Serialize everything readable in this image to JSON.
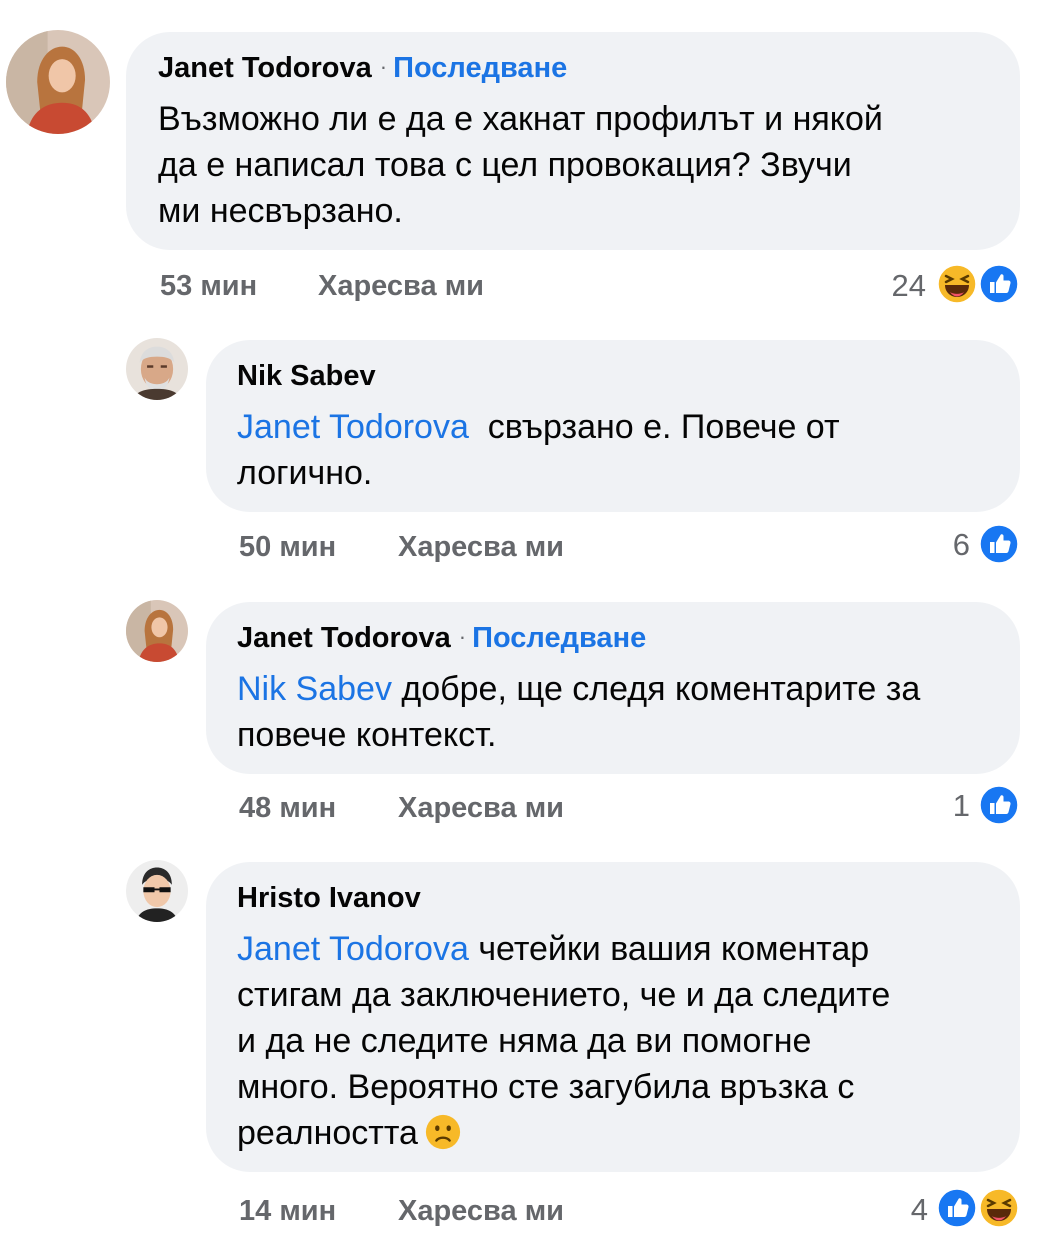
{
  "comments": [
    {
      "author": "Janet Todorova",
      "follow": "Последване",
      "mention": "",
      "lines": [
        "Възможно ли е да е хакнат профилът и някой",
        "да е написал това с цел провокация? Звучи",
        "ми несвързано."
      ],
      "time": "53 мин",
      "like": "Харесва ми",
      "count": "24",
      "reactions": [
        "haha",
        "like"
      ]
    },
    {
      "author": "Nik Sabev",
      "mention": "Janet Todorova",
      "lines": [
        "свързано е. Повече от",
        "логично."
      ],
      "time": "50 мин",
      "like": "Харесва ми",
      "count": "6",
      "reactions": [
        "like"
      ]
    },
    {
      "author": "Janet Todorova",
      "follow": "Последване",
      "mention": "Nik Sabev",
      "lines": [
        "добре, ще следя коментарите за",
        "повече контекст."
      ],
      "time": "48 мин",
      "like": "Харесва ми",
      "count": "1",
      "reactions": [
        "like"
      ]
    },
    {
      "author": "Hristo Ivanov",
      "mention": "Janet Todorova",
      "lines": [
        "четейки вашия коментар",
        "стигам да заключението, че и да следите",
        "и да не следите няма да ви помогне",
        "много. Вероятно сте загубила връзка с",
        "реалността"
      ],
      "time": "14 мин",
      "like": "Харесва ми",
      "count": "4",
      "reactions": [
        "like",
        "haha"
      ],
      "trailing_emoji": "frowning-face"
    }
  ],
  "colors": {
    "link": "#1b74e4",
    "bubble": "#f0f2f5",
    "meta": "#65676b",
    "like_blue": "#1877f2",
    "haha_yellow": "#f7b928"
  }
}
